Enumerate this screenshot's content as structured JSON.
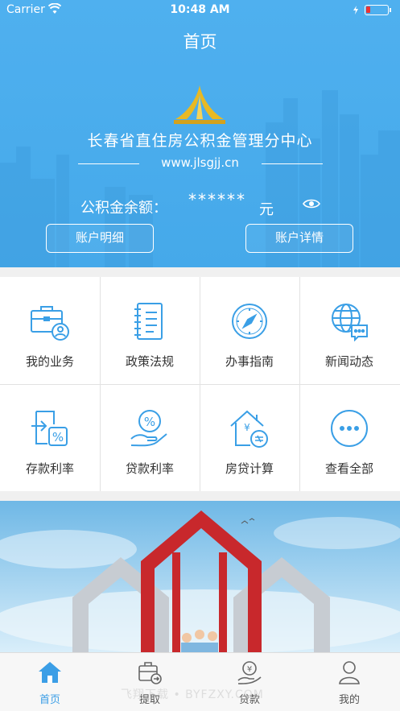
{
  "status_bar": {
    "carrier": "Carrier",
    "time": "10:48 AM"
  },
  "nav": {
    "title": "首页"
  },
  "org": {
    "name": "长春省直住房公积金管理分中心",
    "website": "www.jlsgjj.cn"
  },
  "balance": {
    "label": "公积金余额：",
    "value": "******",
    "unit": "元"
  },
  "buttons": {
    "account_detail": "账户明细",
    "account_info": "账户详情"
  },
  "grid": [
    {
      "label": "我的业务",
      "icon": "briefcase-user-icon"
    },
    {
      "label": "政策法规",
      "icon": "notebook-icon"
    },
    {
      "label": "办事指南",
      "icon": "compass-icon"
    },
    {
      "label": "新闻动态",
      "icon": "globe-chat-icon"
    },
    {
      "label": "存款利率",
      "icon": "deposit-rate-icon"
    },
    {
      "label": "贷款利率",
      "icon": "loan-rate-icon"
    },
    {
      "label": "房贷计算",
      "icon": "house-calculator-icon"
    },
    {
      "label": "查看全部",
      "icon": "more-icon"
    }
  ],
  "tabs": [
    {
      "label": "首页",
      "icon": "home-icon",
      "active": true
    },
    {
      "label": "提取",
      "icon": "withdraw-icon",
      "active": false
    },
    {
      "label": "贷款",
      "icon": "loan-icon",
      "active": false
    },
    {
      "label": "我的",
      "icon": "user-icon",
      "active": false
    }
  ],
  "watermark": "飞翔下载 • BYFZXY.COM",
  "colors": {
    "primary": "#48abee",
    "icon": "#3a9fe6",
    "text": "#333333",
    "tab_active": "#3b9ee6"
  }
}
